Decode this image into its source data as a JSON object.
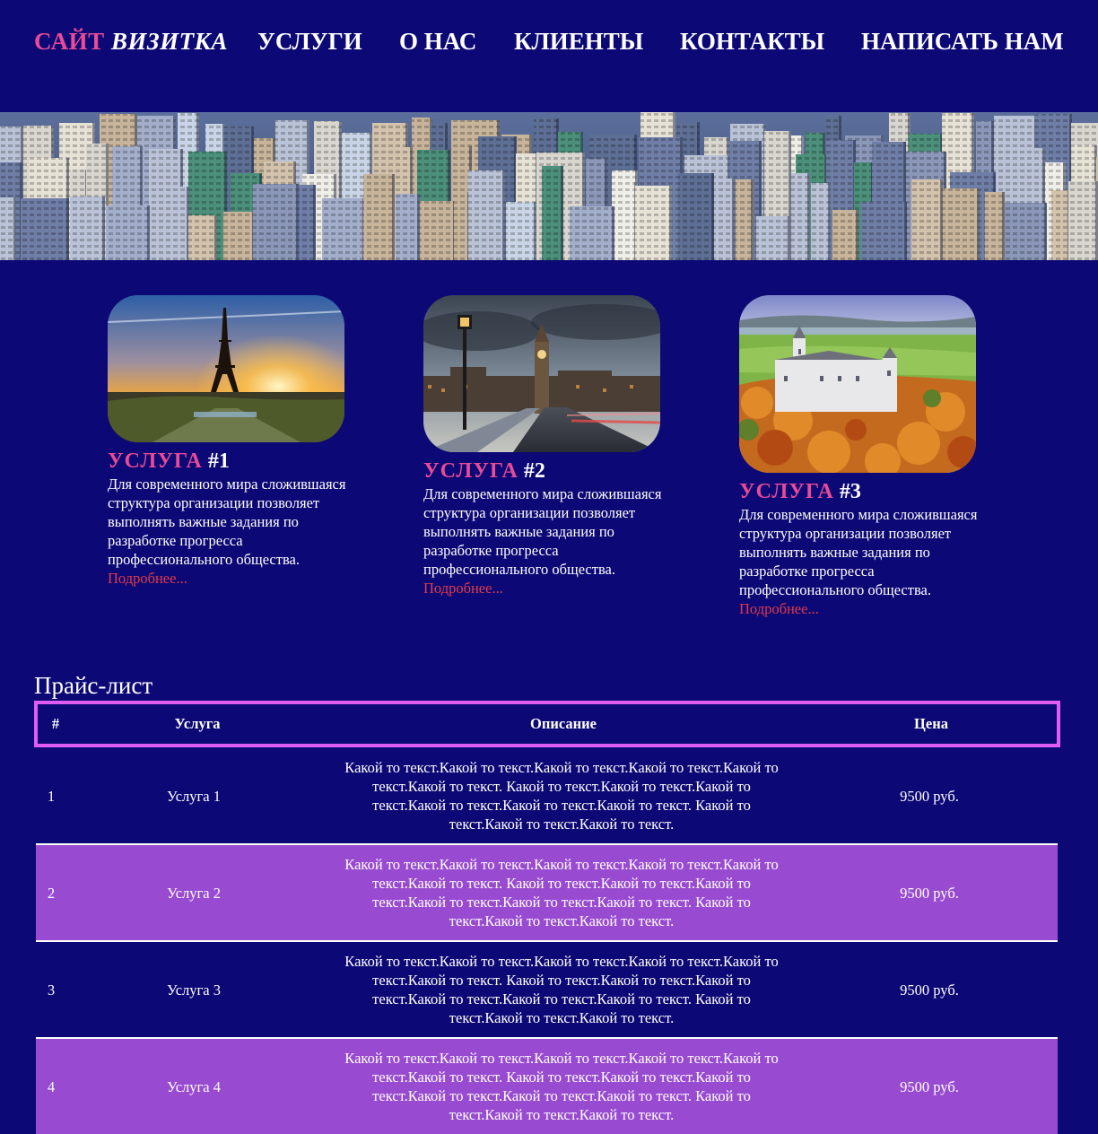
{
  "nav": {
    "logo_part1": "САЙТ",
    "logo_part2": "ВИЗИТКА",
    "items": [
      "УСЛУГИ",
      "О НАС",
      "КЛИЕНТЫ",
      "КОНТАКТЫ",
      "НАПИСАТЬ НАМ"
    ]
  },
  "hero": {
    "image": "city-skyline-photo"
  },
  "cards": [
    {
      "image": "eiffel-tower-photo",
      "title_word": "УСЛУГА",
      "title_num": "#1",
      "text": "Для современного мира сложившаяся структура организации позволяет выполнять важные задания по разработке прогресса профессионального общества.",
      "link": "Подробнее..."
    },
    {
      "image": "big-ben-photo",
      "title_word": "УСЛУГА",
      "title_num": "#2",
      "text": "Для современного мира сложившаяся структура организации позволяет выполнять важные задания по разработке прогресса профессионального общества.",
      "link": "Подробнее..."
    },
    {
      "image": "neuschwanstein-castle-photo",
      "title_word": "УСЛУГА",
      "title_num": "#3",
      "text": "Для современного мира сложившаяся структура организации позволяет выполнять важные задания по разработке прогресса профессионального общества.",
      "link": "Подробнее..."
    }
  ],
  "price": {
    "title": "Прайс-лист",
    "headers": [
      "#",
      "Услуга",
      "Описание",
      "Цена"
    ],
    "rows": [
      {
        "num": "1",
        "service": "Услуга 1",
        "desc": "Какой то текст.Какой то текст.Какой то текст.Какой то текст.Какой то текст.Какой то текст. Какой то текст.Какой то текст.Какой то текст.Какой то текст.Какой то текст.Какой то текст. Какой то текст.Какой то текст.Какой то текст.",
        "price": "9500 руб."
      },
      {
        "num": "2",
        "service": "Услуга 2",
        "desc": "Какой то текст.Какой то текст.Какой то текст.Какой то текст.Какой то текст.Какой то текст. Какой то текст.Какой то текст.Какой то текст.Какой то текст.Какой то текст.Какой то текст. Какой то текст.Какой то текст.Какой то текст.",
        "price": "9500 руб."
      },
      {
        "num": "3",
        "service": "Услуга 3",
        "desc": "Какой то текст.Какой то текст.Какой то текст.Какой то текст.Какой то текст.Какой то текст. Какой то текст.Какой то текст.Какой то текст.Какой то текст.Какой то текст.Какой то текст. Какой то текст.Какой то текст.Какой то текст.",
        "price": "9500 руб."
      },
      {
        "num": "4",
        "service": "Услуга 4",
        "desc": "Какой то текст.Какой то текст.Какой то текст.Какой то текст.Какой то текст.Какой то текст. Какой то текст.Какой то текст.Какой то текст.Какой то текст.Какой то текст.Какой то текст. Какой то текст.Какой то текст.Какой то текст.",
        "price": "9500 руб."
      }
    ]
  },
  "colors": {
    "background": "#0c0875",
    "accent_pink": "#e84b97",
    "link_red": "#e23b4a",
    "row_purple": "#984bd1",
    "header_border": "#e05cf3"
  }
}
